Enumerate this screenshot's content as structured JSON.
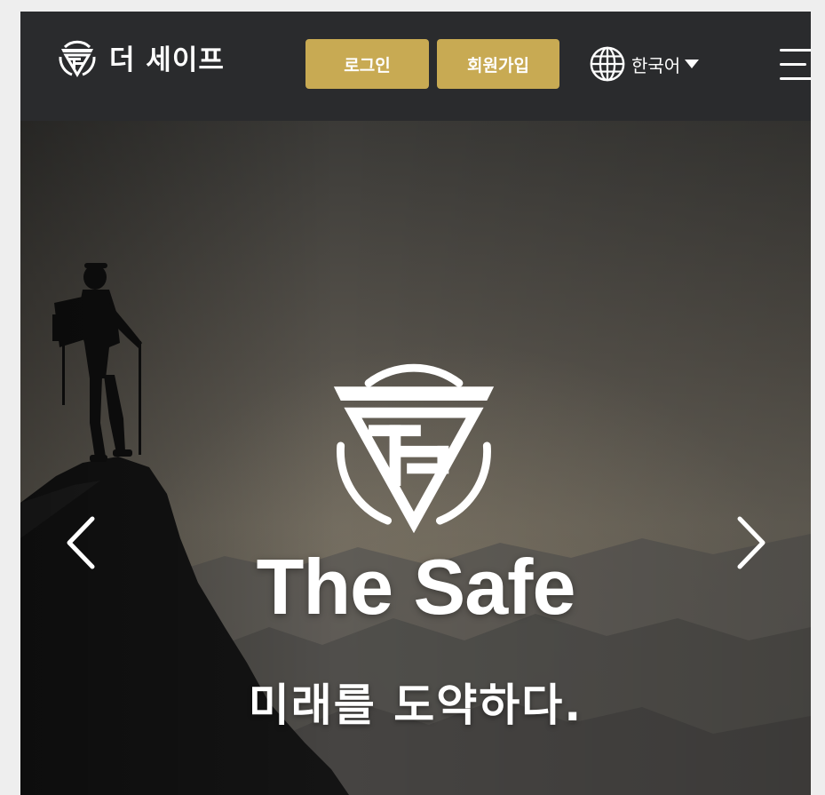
{
  "header": {
    "brand_name": "더 세이프",
    "login_label": "로그인",
    "signup_label": "회원가입",
    "language_label": "한국어",
    "accent_color": "#c8aa53",
    "background_color": "#2a2b2d"
  },
  "icons": {
    "brand_logo": "the-safe-ts-logo-icon",
    "language": "globe-icon",
    "language_caret": "caret-down-icon",
    "menu": "hamburger-menu-icon",
    "prev": "chevron-left-icon",
    "next": "chevron-right-icon"
  },
  "hero": {
    "title": "The Safe",
    "subtitle": "미래를 도약하다."
  }
}
